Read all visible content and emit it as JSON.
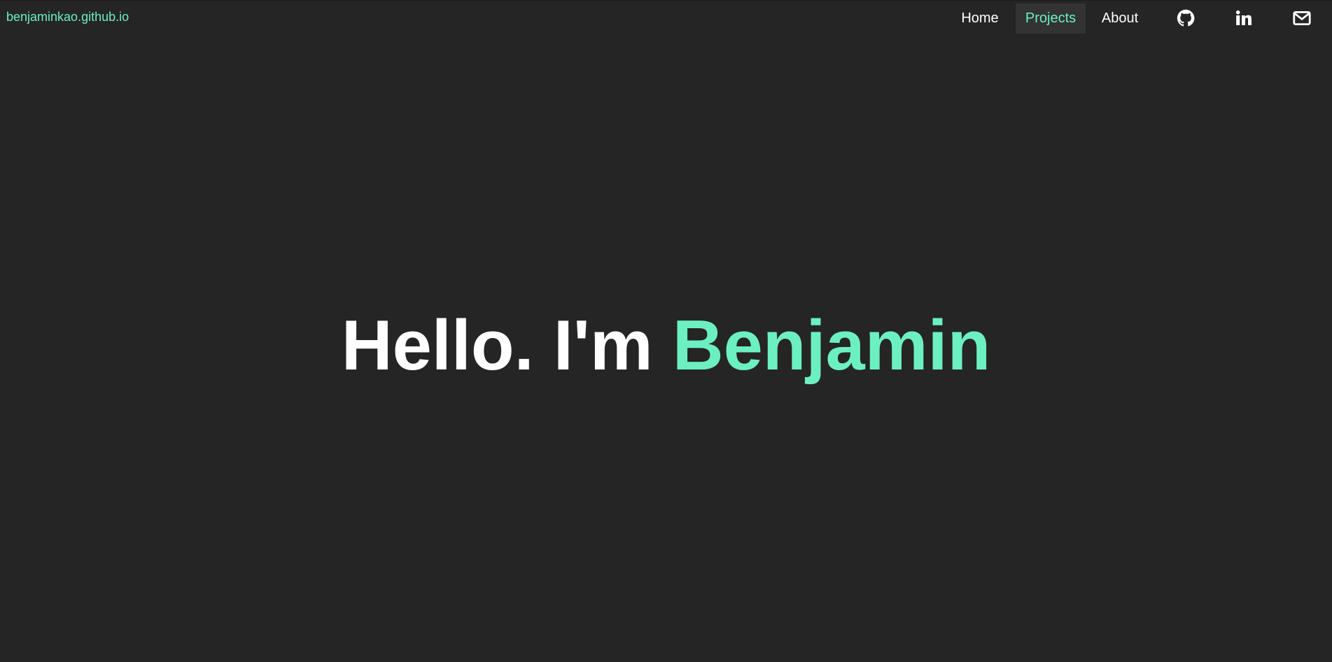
{
  "header": {
    "brand": "benjaminkao.github.io",
    "nav": [
      {
        "label": "Home",
        "active": false
      },
      {
        "label": "Projects",
        "active": true
      },
      {
        "label": "About",
        "active": false
      }
    ],
    "icons": [
      "github-icon",
      "linkedin-icon",
      "mail-icon"
    ]
  },
  "hero": {
    "greeting": "Hello. I'm",
    "name": "Benjamin"
  },
  "colors": {
    "background": "#252525",
    "accent": "#6cf0c2",
    "text": "#ffffff",
    "active_nav_bg": "#333333"
  }
}
